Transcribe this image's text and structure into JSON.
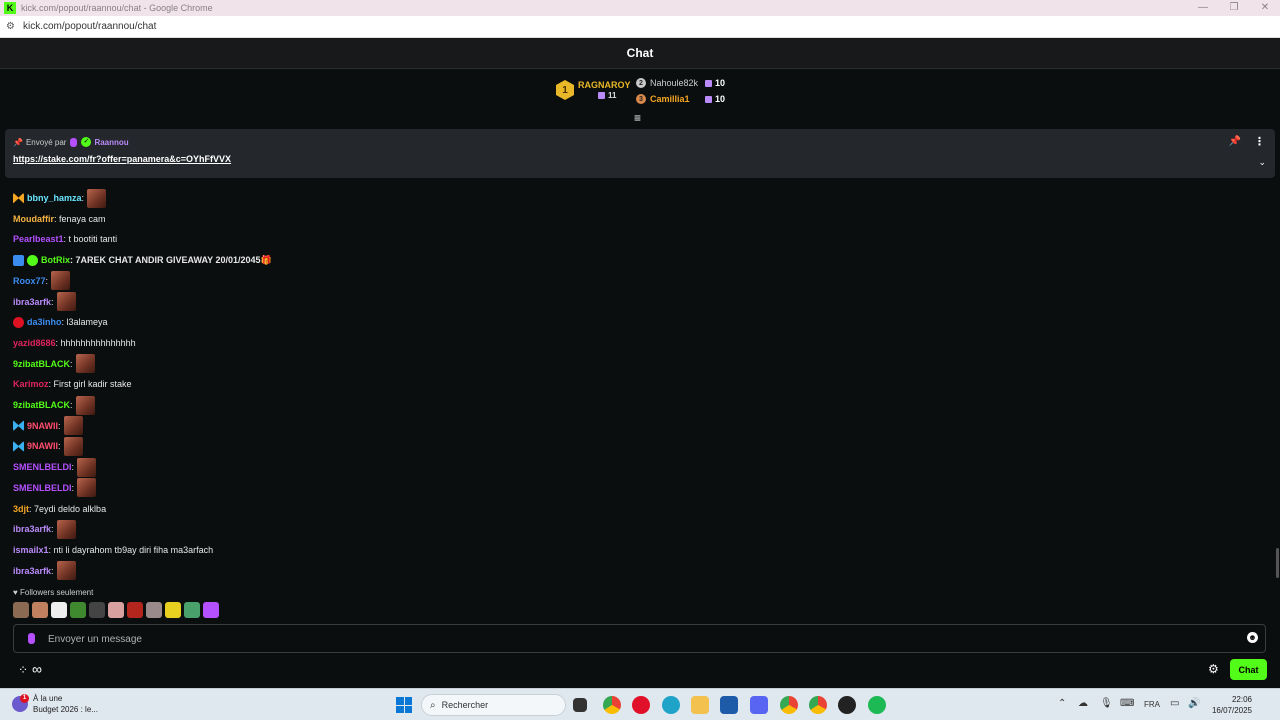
{
  "browser": {
    "title": "kick.com/popout/raannou/chat - Google Chrome",
    "url": "kick.com/popout/raannou/chat",
    "favicon_letter": "K"
  },
  "chat": {
    "header": "Chat",
    "leaderboard": {
      "first": {
        "rank": "1",
        "name": "RAGNAROY",
        "count": "11"
      },
      "others": [
        {
          "rank": "2",
          "name": "Nahoule82k",
          "count": "10"
        },
        {
          "rank": "3",
          "name": "Camillia1",
          "count": "10"
        }
      ]
    },
    "pinned": {
      "sent_by_label": "Envoyé par",
      "author": "Raannou",
      "link": "https://stake.com/fr?offer=panamera&c=OYhFfVVX"
    },
    "messages": [
      {
        "user": "bbny_hamza",
        "text": "",
        "emote": true,
        "color": "#6ae4ff",
        "badge": "butterfly-orange"
      },
      {
        "user": "Moudaffir",
        "text": ": fenaya cam",
        "emote": false,
        "color": "#f5b342",
        "badge": ""
      },
      {
        "user": "Pearlbeast1",
        "text": ": t bootiti tanti",
        "emote": false,
        "color": "#b450ff",
        "badge": ""
      },
      {
        "user": "BotRix",
        "text": ": 7AREK CHAT ANDIR GIVEAWAY 20/01/2045🎁",
        "emote": false,
        "color": "#53fc18",
        "badge": "bot"
      },
      {
        "user": "Roox77",
        "text": "",
        "emote": true,
        "color": "#3b8cf0",
        "badge": ""
      },
      {
        "user": "ibra3arfk",
        "text": "",
        "emote": true,
        "color": "#b98af9",
        "badge": ""
      },
      {
        "user": "da3inho",
        "text": ": l3alameya",
        "emote": false,
        "color": "#3b8cf0",
        "badge": "crab"
      },
      {
        "user": "yazid8686",
        "text": ": hhhhhhhhhhhhhhh",
        "emote": false,
        "color": "#e0245e",
        "badge": ""
      },
      {
        "user": "9zibatBLACK",
        "text": "",
        "emote": true,
        "color": "#53fc18",
        "badge": ""
      },
      {
        "user": "Karimoz",
        "text": ": First girl kadir stake",
        "emote": false,
        "color": "#e0245e",
        "badge": ""
      },
      {
        "user": "9zibatBLACK",
        "text": "",
        "emote": true,
        "color": "#53fc18",
        "badge": ""
      },
      {
        "user": "9NAWII",
        "text": "",
        "emote": true,
        "color": "#ff4d6d",
        "badge": "butterfly-blue"
      },
      {
        "user": "9NAWII",
        "text": "",
        "emote": true,
        "color": "#ff4d6d",
        "badge": "butterfly-blue"
      },
      {
        "user": "SMENLBELDI",
        "text": "",
        "emote": true,
        "color": "#b450ff",
        "badge": ""
      },
      {
        "user": "SMENLBELDI",
        "text": "",
        "emote": true,
        "color": "#b450ff",
        "badge": ""
      },
      {
        "user": "3djt",
        "text": ": 7eydi deldo alklba",
        "emote": false,
        "color": "#f5a623",
        "badge": ""
      },
      {
        "user": "ibra3arfk",
        "text": "",
        "emote": true,
        "color": "#b98af9",
        "badge": ""
      },
      {
        "user": "ismailx1",
        "text": ": nti li dayrahom tb9ay diri fiha ma3arfach",
        "emote": false,
        "color": "#b98af9",
        "badge": ""
      },
      {
        "user": "ibra3arfk",
        "text": "",
        "emote": true,
        "color": "#b98af9",
        "badge": ""
      }
    ],
    "followers_only": "Followers seulement",
    "input_placeholder": "Envoyer un message",
    "send_button": "Chat"
  },
  "taskbar": {
    "news_title": "À la une",
    "news_sub": "Budget 2026 : le...",
    "news_badge": "1",
    "search_placeholder": "Rechercher",
    "language": "FRA",
    "time": "22:06",
    "date": "16/07/2025"
  },
  "colors": {
    "kick_green": "#53fc18",
    "background": "#0b0e0f",
    "panel": "#24272c"
  }
}
